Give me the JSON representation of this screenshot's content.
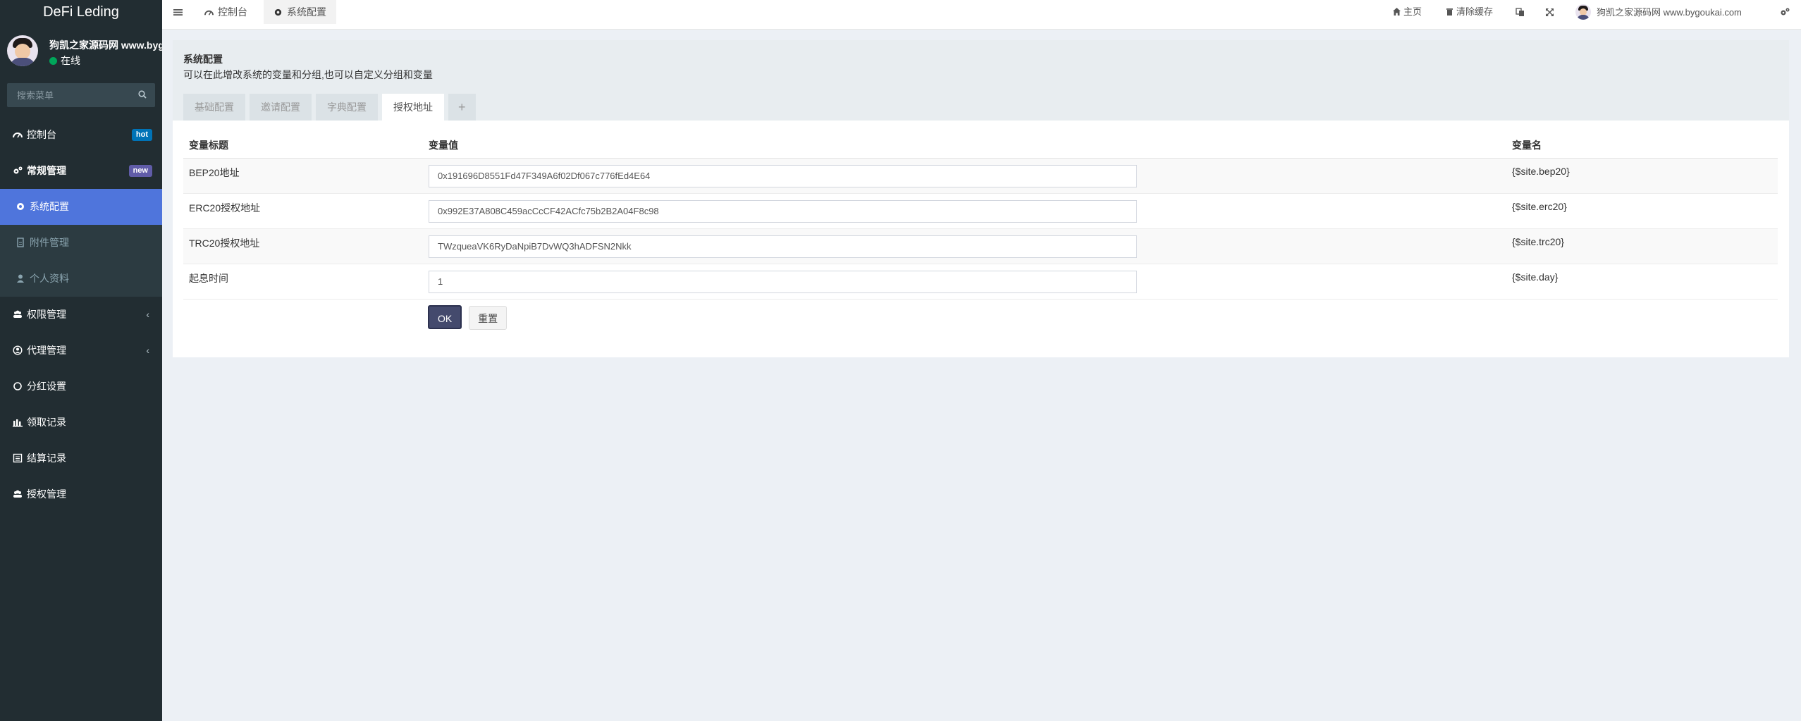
{
  "app": {
    "title": "DeFi Leding"
  },
  "user": {
    "name": "狗凯之家源码网 www.bygoukai.com",
    "status": "在线"
  },
  "sidebar": {
    "search_placeholder": "搜索菜单",
    "items": [
      {
        "label": "控制台",
        "icon": "dashboard-icon",
        "badge": "hot"
      },
      {
        "label": "常规管理",
        "icon": "cogs-icon",
        "badge": "new"
      },
      {
        "label": "系统配置",
        "icon": "gear-icon",
        "active": true
      },
      {
        "label": "附件管理",
        "icon": "file-icon"
      },
      {
        "label": "个人资料",
        "icon": "user-icon"
      },
      {
        "label": "权限管理",
        "icon": "group-icon",
        "chevron": "‹"
      },
      {
        "label": "代理管理",
        "icon": "user-circle-icon",
        "chevron": "‹"
      },
      {
        "label": "分红设置",
        "icon": "circle-icon"
      },
      {
        "label": "领取记录",
        "icon": "bars-icon"
      },
      {
        "label": "结算记录",
        "icon": "ledger-icon"
      },
      {
        "label": "授权管理",
        "icon": "group-icon"
      }
    ]
  },
  "topbar": {
    "menu_icon": "hamburger-icon",
    "tabs": [
      {
        "label": "控制台",
        "icon": "dashboard-icon"
      },
      {
        "label": "系统配置",
        "icon": "gear-icon",
        "active": true
      }
    ],
    "home_label": "主页",
    "clear_cache_label": "清除缓存",
    "user_name": "狗凯之家源码网 www.bygoukai.com"
  },
  "panel": {
    "title": "系统配置",
    "description": "可以在此增改系统的变量和分组,也可以自定义分组和变量",
    "tabs": [
      "基础配置",
      "邀请配置",
      "字典配置",
      "授权地址",
      "+"
    ],
    "active_tab": "授权地址"
  },
  "table": {
    "headers": [
      "变量标题",
      "变量值",
      "变量名"
    ],
    "rows": [
      {
        "title": "BEP20地址",
        "value": "0x191696D8551Fd47F349A6f02Df067c776fEd4E64",
        "name": "{$site.bep20}"
      },
      {
        "title": "ERC20授权地址",
        "value": "0x992E37A808C459acCcCF42ACfc75b2B2A04F8c98",
        "name": "{$site.erc20}"
      },
      {
        "title": "TRC20授权地址",
        "value": "TWzqueaVK6RyDaNpiB7DvWQ3hADFSN2Nkk",
        "name": "{$site.trc20}"
      },
      {
        "title": "起息时间",
        "value": "1",
        "name": "{$site.day}"
      }
    ]
  },
  "buttons": {
    "ok": "OK",
    "reset": "重置"
  },
  "colors": {
    "sidebar_bg": "#222d32",
    "active_item": "#4f75dc",
    "ok_button": "#444a6d"
  }
}
